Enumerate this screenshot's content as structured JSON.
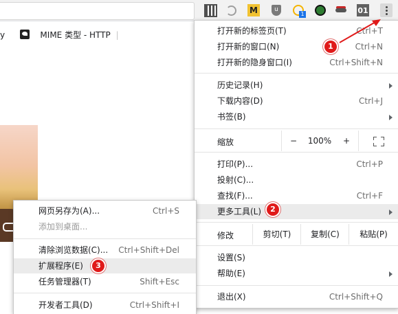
{
  "toolbar": {
    "extensions": [
      {
        "name": "qr-code-icon",
        "text": "",
        "color": "#333333"
      },
      {
        "name": "history-icon",
        "text": "",
        "color": "#9e9e9e"
      },
      {
        "name": "m-extension-icon",
        "text": "M",
        "color": "#f1c232"
      },
      {
        "name": "ublock-icon",
        "text": "",
        "color": "#7a7a7a"
      },
      {
        "name": "checker-icon",
        "text": "",
        "color": "#1a73e8"
      },
      {
        "name": "lock-extension-icon",
        "text": "",
        "color": "#2e7d32"
      },
      {
        "name": "incognito-extension-icon",
        "text": "",
        "color": "#555555"
      },
      {
        "name": "binary-01-icon",
        "text": "01",
        "color": "#616161"
      }
    ],
    "checker_badge": "1",
    "menu_button_icon": "kebab-icon"
  },
  "tab": {
    "prefix": "y",
    "title": "MIME 类型 - HTTP"
  },
  "main_menu": {
    "new_tab": {
      "label": "打开新的标签页(T)",
      "shortcut": "Ctrl+T"
    },
    "new_window": {
      "label": "打开新的窗口(N)",
      "shortcut": "Ctrl+N"
    },
    "new_incognito": {
      "label": "打开新的隐身窗口(I)",
      "shortcut": "Ctrl+Shift+N"
    },
    "history": {
      "label": "历史记录(H)"
    },
    "downloads": {
      "label": "下载内容(D)",
      "shortcut": "Ctrl+J"
    },
    "bookmarks": {
      "label": "书签(B)"
    },
    "zoom": {
      "label": "缩放",
      "minus": "−",
      "value": "100%",
      "plus": "+"
    },
    "print": {
      "label": "打印(P)...",
      "shortcut": "Ctrl+P"
    },
    "cast": {
      "label": "投射(C)..."
    },
    "find": {
      "label": "查找(F)...",
      "shortcut": "Ctrl+F"
    },
    "more_tools": {
      "label": "更多工具(L)"
    },
    "edit": {
      "label": "修改",
      "cut": "剪切(T)",
      "copy": "复制(C)",
      "paste": "粘贴(P)"
    },
    "settings": {
      "label": "设置(S)"
    },
    "help": {
      "label": "帮助(E)"
    },
    "exit": {
      "label": "退出(X)",
      "shortcut": "Ctrl+Shift+Q"
    }
  },
  "submenu": {
    "save_page": {
      "label": "网页另存为(A)...",
      "shortcut": "Ctrl+S"
    },
    "add_to_desktop": {
      "label": "添加到桌面..."
    },
    "clear_data": {
      "label": "清除浏览数据(C)...",
      "shortcut": "Ctrl+Shift+Del"
    },
    "extensions": {
      "label": "扩展程序(E)"
    },
    "task_manager": {
      "label": "任务管理器(T)",
      "shortcut": "Shift+Esc"
    },
    "dev_tools": {
      "label": "开发者工具(D)",
      "shortcut": "Ctrl+Shift+I"
    }
  },
  "annotations": {
    "step1": "1",
    "step2": "2",
    "step3": "3",
    "arrow_color": "#e01a1a"
  }
}
